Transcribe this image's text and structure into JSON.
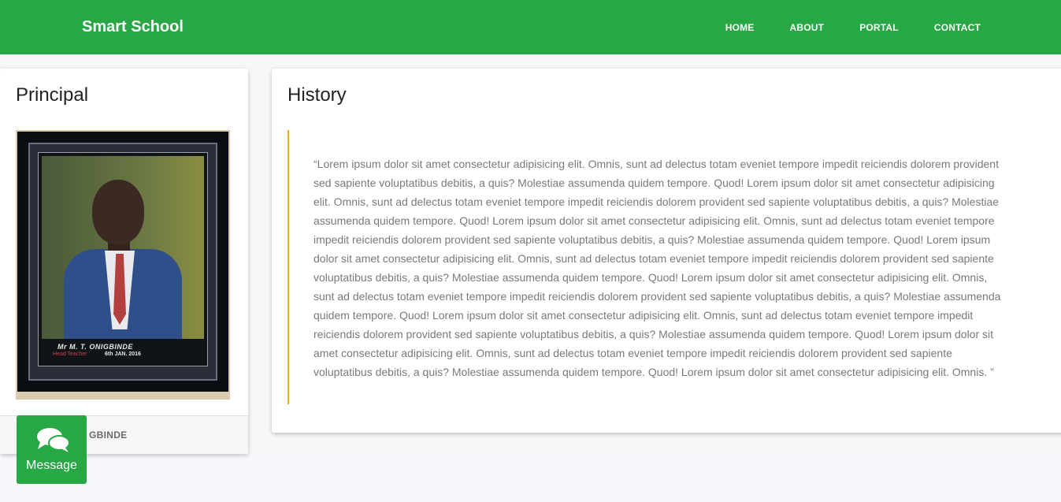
{
  "navbar": {
    "brand": "Smart School",
    "links": [
      "HOME",
      "ABOUT",
      "PORTAL",
      "CONTACT"
    ],
    "background_color": "#28a745"
  },
  "principal": {
    "title": "Principal",
    "photo_plaque_name": "Mr M. T. ONIGBINDE",
    "photo_plaque_role": "Head Teacher",
    "photo_plaque_date": "6th JAN. 2016",
    "name_visible": "GBINDE"
  },
  "history": {
    "title": "History",
    "quote": "“Lorem ipsum dolor sit amet consectetur adipisicing elit. Omnis, sunt ad delectus totam eveniet tempore impedit reiciendis dolorem provident sed sapiente voluptatibus debitis, a quis? Molestiae assumenda quidem tempore. Quod! Lorem ipsum dolor sit amet consectetur adipisicing elit. Omnis, sunt ad delectus totam eveniet tempore impedit reiciendis dolorem provident sed sapiente voluptatibus debitis, a quis? Molestiae assumenda quidem tempore. Quod! Lorem ipsum dolor sit amet consectetur adipisicing elit. Omnis, sunt ad delectus totam eveniet tempore impedit reiciendis dolorem provident sed sapiente voluptatibus debitis, a quis? Molestiae assumenda quidem tempore. Quod! Lorem ipsum dolor sit amet consectetur adipisicing elit. Omnis, sunt ad delectus totam eveniet tempore impedit reiciendis dolorem provident sed sapiente voluptatibus debitis, a quis? Molestiae assumenda quidem tempore. Quod! Lorem ipsum dolor sit amet consectetur adipisicing elit. Omnis, sunt ad delectus totam eveniet tempore impedit reiciendis dolorem provident sed sapiente voluptatibus debitis, a quis? Molestiae assumenda quidem tempore. Quod! Lorem ipsum dolor sit amet consectetur adipisicing elit. Omnis, sunt ad delectus totam eveniet tempore impedit reiciendis dolorem provident sed sapiente voluptatibus debitis, a quis? Molestiae assumenda quidem tempore. Quod! Lorem ipsum dolor sit amet consectetur adipisicing elit. Omnis, sunt ad delectus totam eveniet tempore impedit reiciendis dolorem provident sed sapiente voluptatibus debitis, a quis? Molestiae assumenda quidem tempore. Quod! Lorem ipsum dolor sit amet consectetur adipisicing elit. Omnis. ”",
    "accent_color": "#e6b422"
  },
  "message_button": {
    "label": "Message",
    "icon": "chat-bubbles-icon"
  }
}
